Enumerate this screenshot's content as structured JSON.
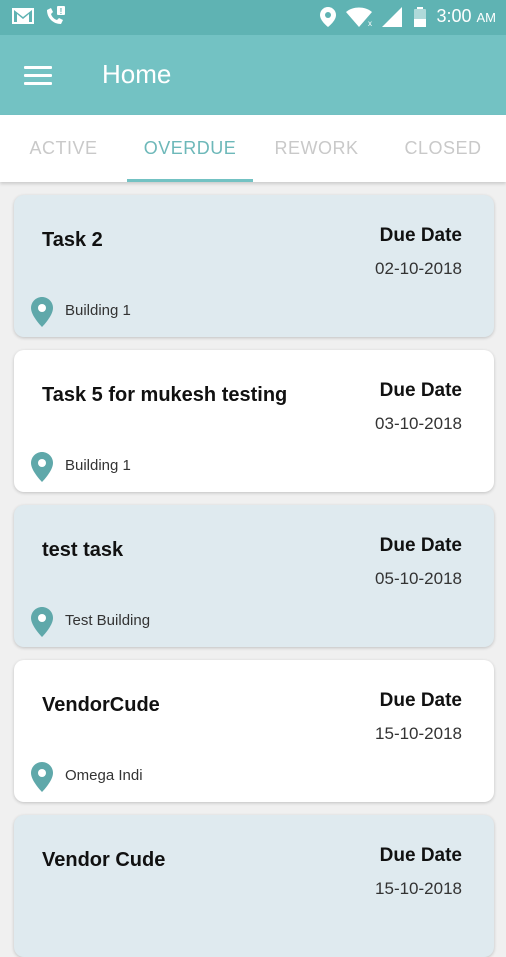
{
  "status_bar": {
    "time": "3:00",
    "ampm": "AM",
    "icons": [
      "gmail-icon",
      "missed-call-icon",
      "location-icon",
      "wifi-icon",
      "signal-icon",
      "battery-icon"
    ]
  },
  "app_bar": {
    "title": "Home",
    "menu_icon": "hamburger-icon"
  },
  "tabs": [
    {
      "label": "ACTIVE",
      "active": false
    },
    {
      "label": "OVERDUE",
      "active": true
    },
    {
      "label": "REWORK",
      "active": false
    },
    {
      "label": "CLOSED",
      "active": false
    }
  ],
  "tasks": [
    {
      "title": "Task 2",
      "due_label": "Due Date",
      "due_date": "02-10-2018",
      "location": "Building 1"
    },
    {
      "title": "Task 5 for mukesh testing",
      "due_label": "Due Date",
      "due_date": "03-10-2018",
      "location": "Building 1"
    },
    {
      "title": "test task",
      "due_label": "Due Date",
      "due_date": "05-10-2018",
      "location": "Test Building"
    },
    {
      "title": "VendorCude",
      "due_label": "Due Date",
      "due_date": "15-10-2018",
      "location": "Omega Indi"
    },
    {
      "title": "Vendor Cude",
      "due_label": "Due Date",
      "due_date": "15-10-2018",
      "location": ""
    }
  ],
  "colors": {
    "status_bar": "#5fb3b3",
    "app_bar": "#73c2c3",
    "accent": "#6db8b9",
    "tinted_card": "#dfeaef",
    "plain_card": "#ffffff",
    "pin": "#5fa8aa"
  }
}
